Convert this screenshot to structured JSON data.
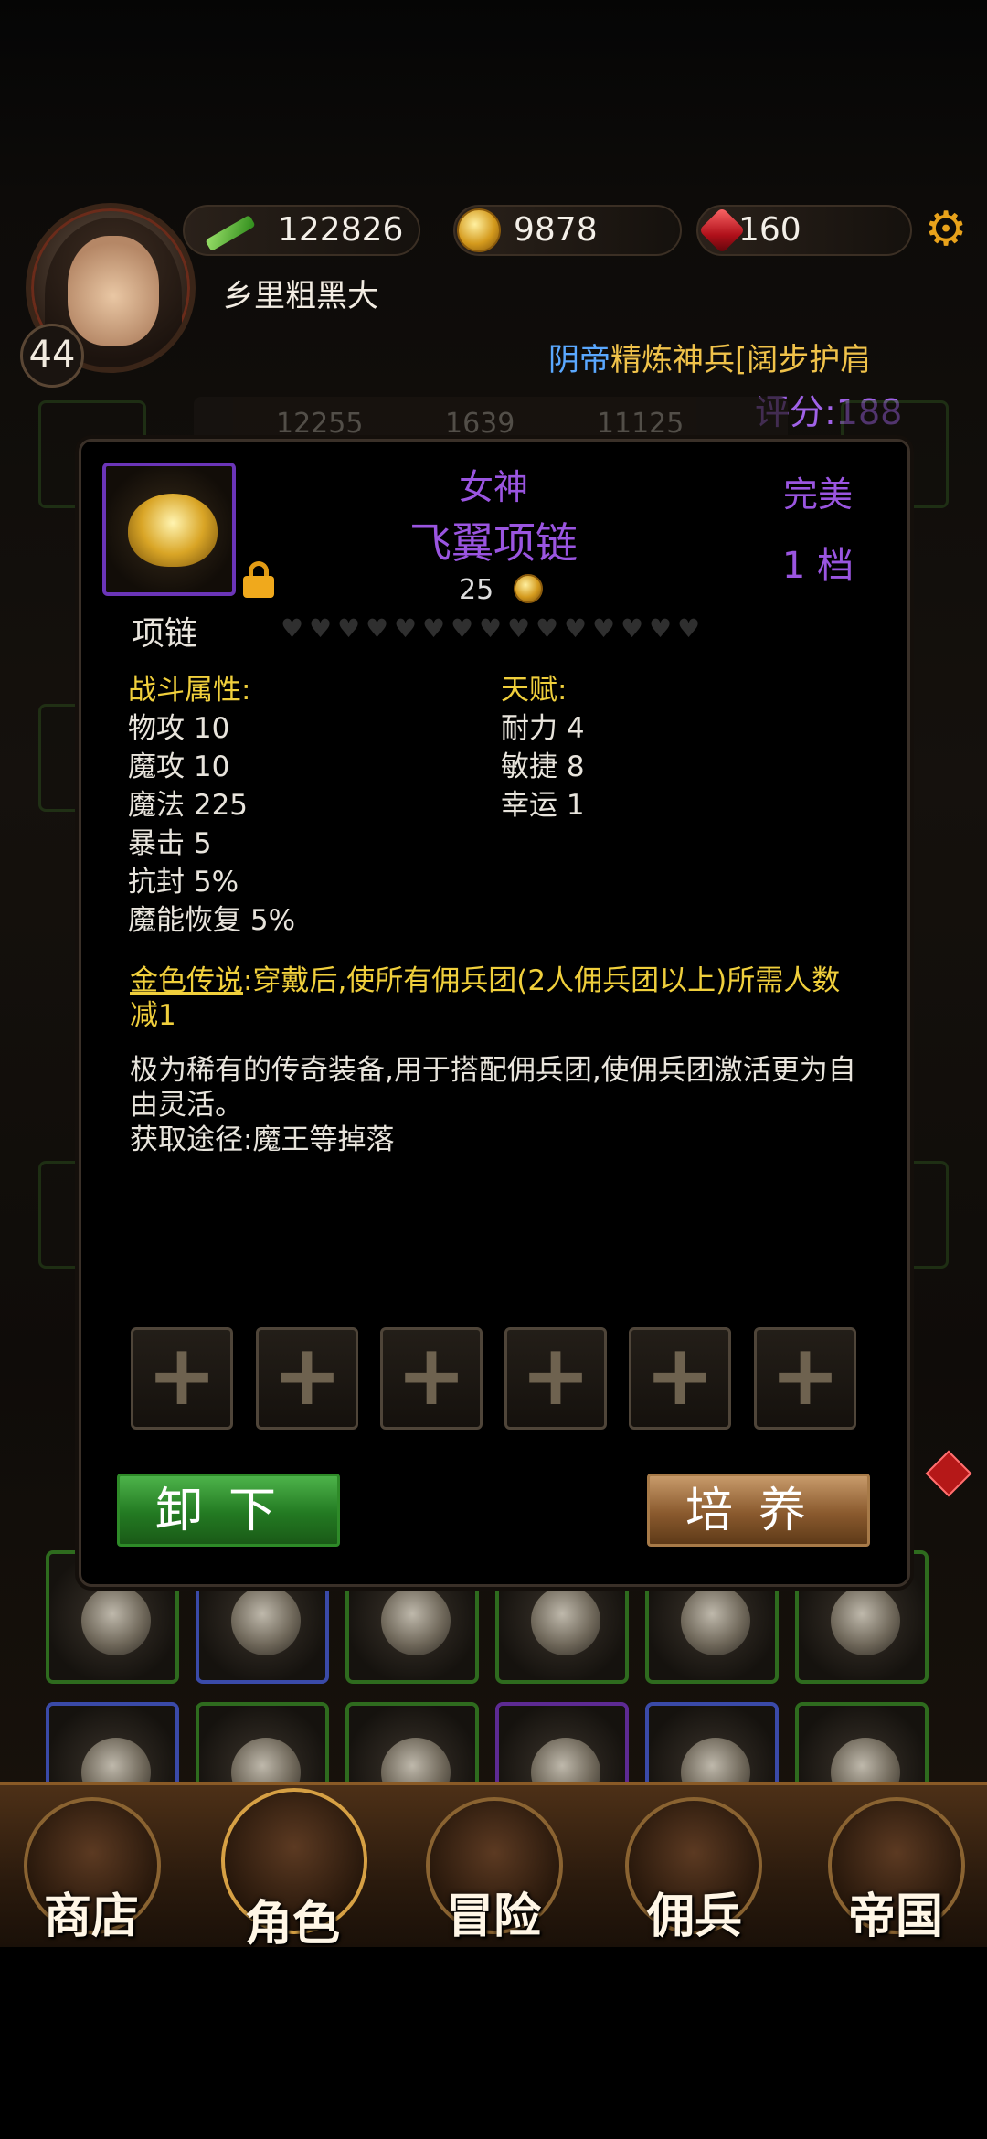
{
  "header": {
    "level": "44",
    "player_name": "乡里粗黑大",
    "power": "122826",
    "gold": "9878",
    "gems": "160",
    "ticker_prefix": "阴帝",
    "ticker_main": "精炼神兵",
    "ticker_tail": "[阔步护肩",
    "rating": "评分:188"
  },
  "background": {
    "stats": [
      "12255",
      "1639",
      "11125"
    ]
  },
  "item": {
    "quality": "女神",
    "name": "飞翼项链",
    "price": "25",
    "grade_label": "完美",
    "tier": "1  档",
    "slot_type": "项链",
    "combat_title": "战斗属性:",
    "combat_stats": [
      "物攻 10",
      "魔攻 10",
      "魔法 225",
      "暴击 5",
      "抗封 5%",
      "魔能恢复 5%"
    ],
    "talent_title": "天赋:",
    "talents": [
      "耐力 4",
      "敏捷 8",
      "幸运 1"
    ],
    "legend_label": "金色传说",
    "legend_text": ":穿戴后,使所有佣兵团(2人佣兵团以上)所需人数减1",
    "description_line1": "极为稀有的传奇装备,用于搭配佣兵团,使佣兵团激活更为自由灵活。",
    "description_line2": "获取途径:魔王等掉落",
    "sockets": [
      "+",
      "+",
      "+",
      "+",
      "+",
      "+"
    ],
    "unequip_label": "卸下",
    "train_label": "培养"
  },
  "nav": {
    "shop": "商店",
    "character": "角色",
    "adventure": "冒险",
    "mercenary": "佣兵",
    "empire": "帝国"
  },
  "colors": {
    "legend_gold": "#f0cf3c",
    "purple_quality": "#9a55e0",
    "ticker_blue": "#5aa8ff"
  }
}
